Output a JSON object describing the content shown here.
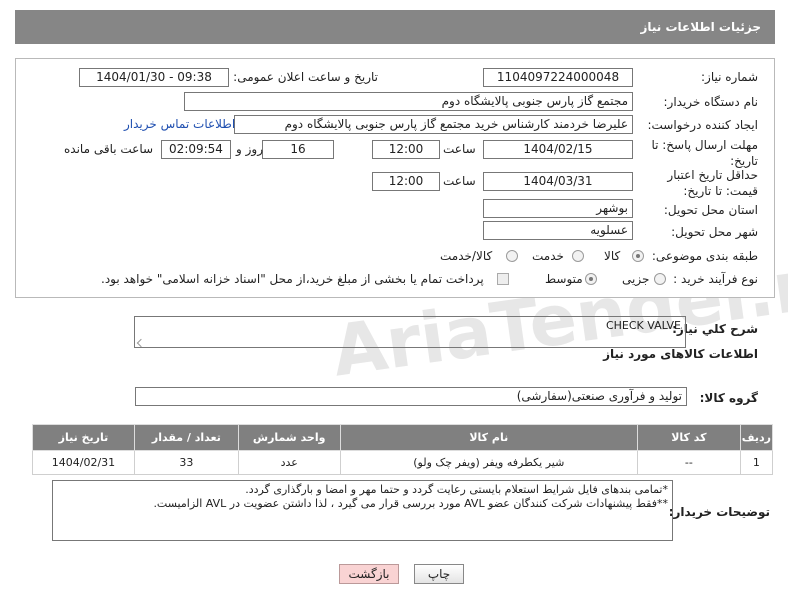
{
  "header": {
    "title": "جزئیات اطلاعات نیاز"
  },
  "fields": {
    "need_number_label": "شماره نیاز:",
    "need_number": "1104097224000048",
    "announce_label": "تاریخ و ساعت اعلان عمومی:",
    "announce_value": "1404/01/30 - 09:38",
    "buyer_org_label": "نام دستگاه خریدار:",
    "buyer_org": "مجتمع گاز پارس جنوبی  پالایشگاه دوم",
    "creator_label": "ایجاد کننده درخواست:",
    "creator": "علیرضا خردمند کارشناس خرید مجتمع گاز پارس جنوبی  پالایشگاه دوم",
    "contact_link": "اطلاعات تماس خریدار",
    "reply_deadline_label": "مهلت ارسال پاسخ: تا تاریخ:",
    "reply_date": "1404/02/15",
    "time_label": "ساعت",
    "reply_time": "12:00",
    "days": "16",
    "days_label": "روز و",
    "remaining": "02:09:54",
    "remaining_label": "ساعت باقی مانده",
    "price_deadline_label": "حداقل تاریخ اعتبار قیمت: تا تاریخ:",
    "price_date": "1404/03/31",
    "price_time": "12:00",
    "province_label": "استان محل تحویل:",
    "province": "بوشهر",
    "city_label": "شهر محل تحویل:",
    "city": "عسلویه",
    "category_label": "طبقه بندی موضوعی:",
    "category_options": [
      "کالا",
      "خدمت",
      "کالا/خدمت"
    ],
    "process_label": "نوع فرآیند خرید :",
    "process_options": [
      "جزیی",
      "متوسط"
    ],
    "payment_note": "پرداخت تمام یا بخشی از مبلغ خرید،از محل \"اسناد خزانه اسلامی\" خواهد بود."
  },
  "summary": {
    "label": "شرح کلي نياز:",
    "value": "CHECK VALVE"
  },
  "goods_info_title": "اطلاعات کالاهای مورد نیاز",
  "goods_group": {
    "label": "گروه کالا:",
    "value": "تولید و فرآوری صنعتی(سفارشی)"
  },
  "table": {
    "headers": [
      "ردیف",
      "کد کالا",
      "نام کالا",
      "واحد شمارش",
      "تعداد / مقدار",
      "تاریخ نیاز"
    ],
    "rows": [
      [
        "1",
        "--",
        "شیر یکطرفه ویفر (ویفر چک ولو)",
        "عدد",
        "33",
        "1404/02/31"
      ]
    ]
  },
  "buyer_notes": {
    "label": "توضیحات خریدار:",
    "line1": "*تمامی بندهای فایل شرایط استعلام بایستی رعایت گردد و حتما مهر و امضا و بارگذاری گردد.",
    "line2": "**فقط پیشنهادات شرکت کنندگان عضو AVL مورد بررسی قرار می گیرد ، لذا داشتن عضویت در AVL الزامیست."
  },
  "buttons": {
    "print": "چاپ",
    "back": "بازگشت"
  },
  "watermark": "AriaTender.neT"
}
